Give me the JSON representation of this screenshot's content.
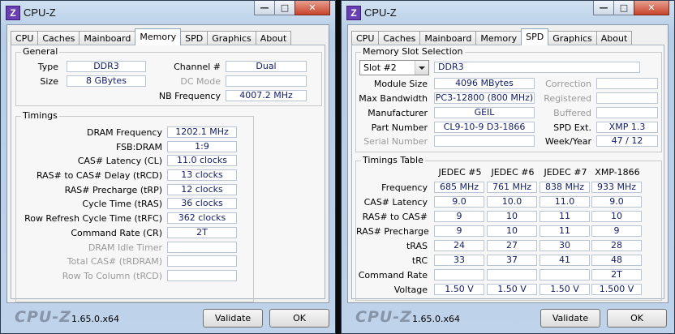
{
  "left": {
    "title": "CPU-Z",
    "app_icon": "Z",
    "tabs": [
      "CPU",
      "Caches",
      "Mainboard",
      "Memory",
      "SPD",
      "Graphics",
      "About"
    ],
    "active_tab": "Memory",
    "general": {
      "title": "General",
      "type_label": "Type",
      "type_value": "DDR3",
      "size_label": "Size",
      "size_value": "8 GBytes",
      "channel_label": "Channel #",
      "channel_value": "Dual",
      "dcmode_label": "DC Mode",
      "dcmode_value": "",
      "nbfreq_label": "NB Frequency",
      "nbfreq_value": "4007.2 MHz"
    },
    "timings": {
      "title": "Timings",
      "rows": [
        {
          "label": "DRAM Frequency",
          "value": "1202.1 MHz",
          "disabled": false
        },
        {
          "label": "FSB:DRAM",
          "value": "1:9",
          "disabled": false
        },
        {
          "label": "CAS# Latency (CL)",
          "value": "11.0 clocks",
          "disabled": false
        },
        {
          "label": "RAS# to CAS# Delay (tRCD)",
          "value": "13 clocks",
          "disabled": false
        },
        {
          "label": "RAS# Precharge (tRP)",
          "value": "12 clocks",
          "disabled": false
        },
        {
          "label": "Cycle Time (tRAS)",
          "value": "36 clocks",
          "disabled": false
        },
        {
          "label": "Row Refresh Cycle Time (tRFC)",
          "value": "362 clocks",
          "disabled": false
        },
        {
          "label": "Command Rate (CR)",
          "value": "2T",
          "disabled": false
        },
        {
          "label": "DRAM Idle Timer",
          "value": "",
          "disabled": true
        },
        {
          "label": "Total CAS# (tRDRAM)",
          "value": "",
          "disabled": true
        },
        {
          "label": "Row To Column (tRCD)",
          "value": "",
          "disabled": true
        }
      ]
    },
    "footer": {
      "brand": "CPU-Z",
      "version": "1.65.0.x64",
      "validate_label": "Validate",
      "ok_label": "OK"
    }
  },
  "right": {
    "title": "CPU-Z",
    "app_icon": "Z",
    "tabs": [
      "CPU",
      "Caches",
      "Mainboard",
      "Memory",
      "SPD",
      "Graphics",
      "About"
    ],
    "active_tab": "SPD",
    "slot": {
      "title": "Memory Slot Selection",
      "selected_slot": "Slot #2",
      "type_value": "DDR3",
      "module_size_label": "Module Size",
      "module_size_value": "4096 MBytes",
      "max_bw_label": "Max Bandwidth",
      "max_bw_value": "PC3-12800 (800 MHz)",
      "manufacturer_label": "Manufacturer",
      "manufacturer_value": "GEIL",
      "part_label": "Part Number",
      "part_value": "CL9-10-9 D3-1866",
      "serial_label": "Serial Number",
      "serial_value": "",
      "correction_label": "Correction",
      "correction_value": "",
      "registered_label": "Registered",
      "registered_value": "",
      "buffered_label": "Buffered",
      "buffered_value": "",
      "spdext_label": "SPD Ext.",
      "spdext_value": "XMP 1.3",
      "weekyear_label": "Week/Year",
      "weekyear_value": "47 / 12"
    },
    "timings_table": {
      "title": "Timings Table",
      "columns": [
        "JEDEC #5",
        "JEDEC #6",
        "JEDEC #7",
        "XMP-1866"
      ],
      "rows": [
        {
          "label": "Frequency",
          "values": [
            "685 MHz",
            "761 MHz",
            "838 MHz",
            "933 MHz"
          ]
        },
        {
          "label": "CAS# Latency",
          "values": [
            "9.0",
            "10.0",
            "11.0",
            "9.0"
          ]
        },
        {
          "label": "RAS# to CAS#",
          "values": [
            "9",
            "10",
            "11",
            "10"
          ]
        },
        {
          "label": "RAS# Precharge",
          "values": [
            "9",
            "10",
            "11",
            "9"
          ]
        },
        {
          "label": "tRAS",
          "values": [
            "24",
            "27",
            "30",
            "28"
          ]
        },
        {
          "label": "tRC",
          "values": [
            "33",
            "37",
            "41",
            "48"
          ]
        },
        {
          "label": "Command Rate",
          "values": [
            "",
            "",
            "",
            "2T"
          ]
        },
        {
          "label": "Voltage",
          "values": [
            "1.50 V",
            "1.50 V",
            "1.50 V",
            "1.500 V"
          ]
        }
      ]
    },
    "footer": {
      "brand": "CPU-Z",
      "version": "1.65.0.x64",
      "validate_label": "Validate",
      "ok_label": "OK"
    }
  },
  "window_buttons": {
    "minimize_icon": "minimize-icon",
    "maximize_icon": "maximize-icon",
    "close_icon": "close-icon",
    "minimize_glyph": "—",
    "maximize_glyph": "□",
    "close_glyph": "✕"
  },
  "colors": {
    "value_text": "#101c72",
    "brand_text": "#8795a8",
    "app_icon": "#6a3fb5"
  }
}
